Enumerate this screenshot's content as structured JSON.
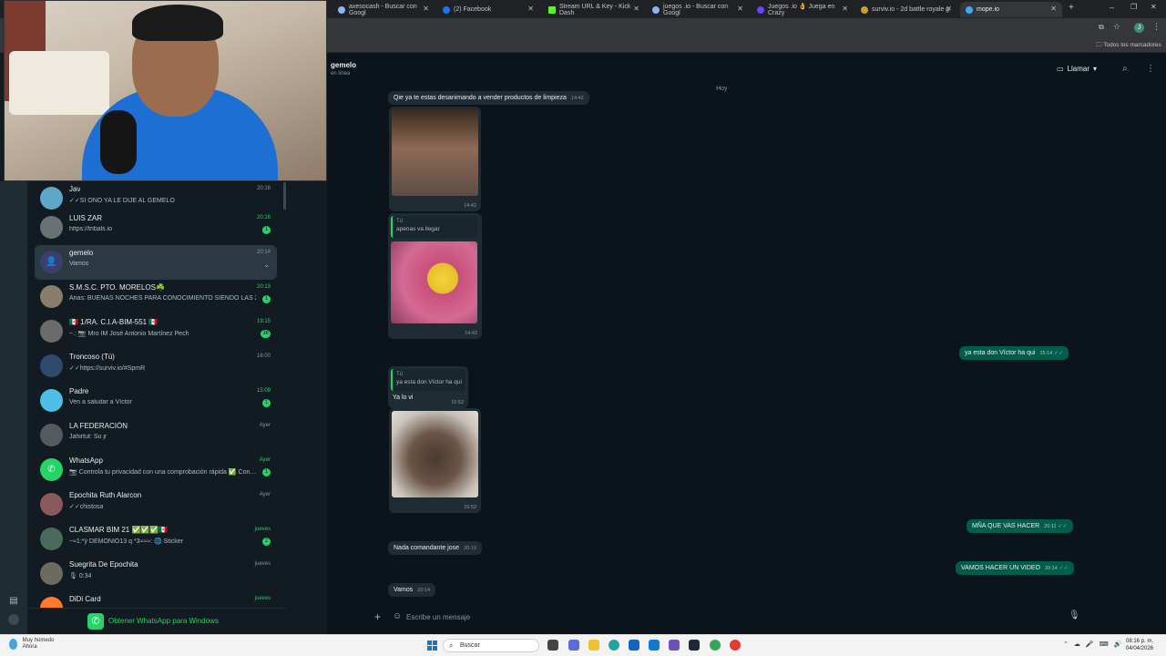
{
  "browser": {
    "tabs": [
      {
        "label": "axesocash - Buscar con Googl",
        "color": "#8ab4f8"
      },
      {
        "label": "(2) Facebook",
        "color": "#1877f2"
      },
      {
        "label": "Stream URL & Key - Kick Dash",
        "color": "#53fc18"
      },
      {
        "label": "juegos .io - Buscar con Googl",
        "color": "#8ab4f8"
      },
      {
        "label": "Juegos .io 👌 Juega en Crazy",
        "color": "#6842ff"
      },
      {
        "label": "surviv.io - 2d battle royale g",
        "color": "#c9a227"
      },
      {
        "label": "mope.io",
        "color": "#3fa9f5"
      }
    ],
    "bookmarks_label": "Todos los marcadores"
  },
  "chat_list": [
    {
      "name": "Jav",
      "preview": "✓✓SI ONO YA LE DIJE AL GEMELO",
      "time": "20:16",
      "unread": "",
      "avatar_color": "#5fa7c9"
    },
    {
      "name": "LUIS ZAR",
      "preview": "https://tribals.io",
      "time": "20:16",
      "unread": "1",
      "avatar_color": "#7a7f83"
    },
    {
      "name": "gemelo",
      "preview": "Vamos",
      "time": "20:14",
      "unread": "",
      "avatar_color": "#3b3f6d"
    },
    {
      "name": "S.M.S.C. PTO. MORELOS☘️",
      "preview": "Arias: BUENAS NOCHES PARA CONOCIMIENTO SIENDO LAS 20:1…",
      "time": "20:13",
      "unread": "1",
      "avatar_color": "#8a7d6b"
    },
    {
      "name": "🇲🇽 1/RA. C.I.A-BIM-551 🇲🇽",
      "preview": "~.: 📷 Mro IM José Antonio Martínez Pech",
      "time": "19:15",
      "unread": "36",
      "avatar_color": "#6b6b6b"
    },
    {
      "name": "Troncoso (Tú)",
      "preview": "✓✓https://surviv.io/#SpmR",
      "time": "16:00",
      "unread": "",
      "avatar_color": "#2f4a6b"
    },
    {
      "name": "Padre",
      "preview": "Ven a saludar a Víctor",
      "time": "15:09",
      "unread": "1",
      "avatar_color": "#4ec0e8"
    },
    {
      "name": "LA FEDERACIÓN",
      "preview": "Jahirtut: Su jr",
      "time": "Ayer",
      "unread": "",
      "avatar_color": "#555a5e"
    },
    {
      "name": "WhatsApp",
      "preview": "📷 Controla tu privacidad con una comprobación rápida ✅ Con…",
      "time": "Ayer",
      "unread": "1",
      "avatar_color": "#25d366"
    },
    {
      "name": "Epochita Ruth Alarcon",
      "preview": "✓✓chistosa",
      "time": "Ayer",
      "unread": "",
      "avatar_color": "#8a5a5a"
    },
    {
      "name": "CLASMAR BIM 21 ✅✅✅🇲🇽",
      "preview": "~≈1:*ÿ DEMONIO13  q *3≈≈≈: 🌐 Sticker",
      "time": "jueves",
      "unread": "2",
      "avatar_color": "#4a6b5a"
    },
    {
      "name": "Suegrita De Epochita",
      "preview": "🎙 0:34",
      "time": "jueves",
      "unread": "",
      "avatar_color": "#6d6a5f"
    },
    {
      "name": "DiDi Card",
      "preview": "",
      "time": "jueves",
      "unread": "",
      "avatar_color": "#ff7a2e"
    }
  ],
  "get_whatsapp": "Obtener WhatsApp para Windows",
  "conversation": {
    "name": "gemelo",
    "status": "en línea",
    "call_label": "Llamar",
    "day_chip": "Hoy",
    "messages": {
      "m1_text": "Qie ya te estas desanimando a vender productos de limpieza",
      "m1_time": "14:42",
      "img1_time": "14:42",
      "reply1_who": "Tú",
      "reply1_quote": "apenas va llegar",
      "img2_time": "14:42",
      "out1_text": "ya esta don Víctor ha qui",
      "out1_time": "15:14",
      "reply2_who": "Tú",
      "reply2_quote": "ya esta don Víctor ha qui",
      "m2_text": "Ya lo vi",
      "m2_time": "15:52",
      "img3_time": "15:52",
      "out2_text": "MÑA QUE VAS HACER",
      "out2_time": "20:11",
      "m3_text": "Nada comandante jose",
      "m3_time": "20:13",
      "out3_text": "VAMOS HACER UN VIDEO",
      "out3_time": "20:14",
      "m4_text": "Vamos",
      "m4_time": "20:14"
    },
    "composer_placeholder": "Escribe un mensaje"
  },
  "taskbar": {
    "weather_line1": "Muy húmedo",
    "weather_line2": "Ahora",
    "search_label": "Buscar",
    "clock_time": "08:16 p. m.",
    "clock_date": "04/04/2026"
  },
  "colors": {
    "accent": "#25d366",
    "outgoing_bubble": "#005c4b",
    "incoming_bubble": "#202c33"
  }
}
